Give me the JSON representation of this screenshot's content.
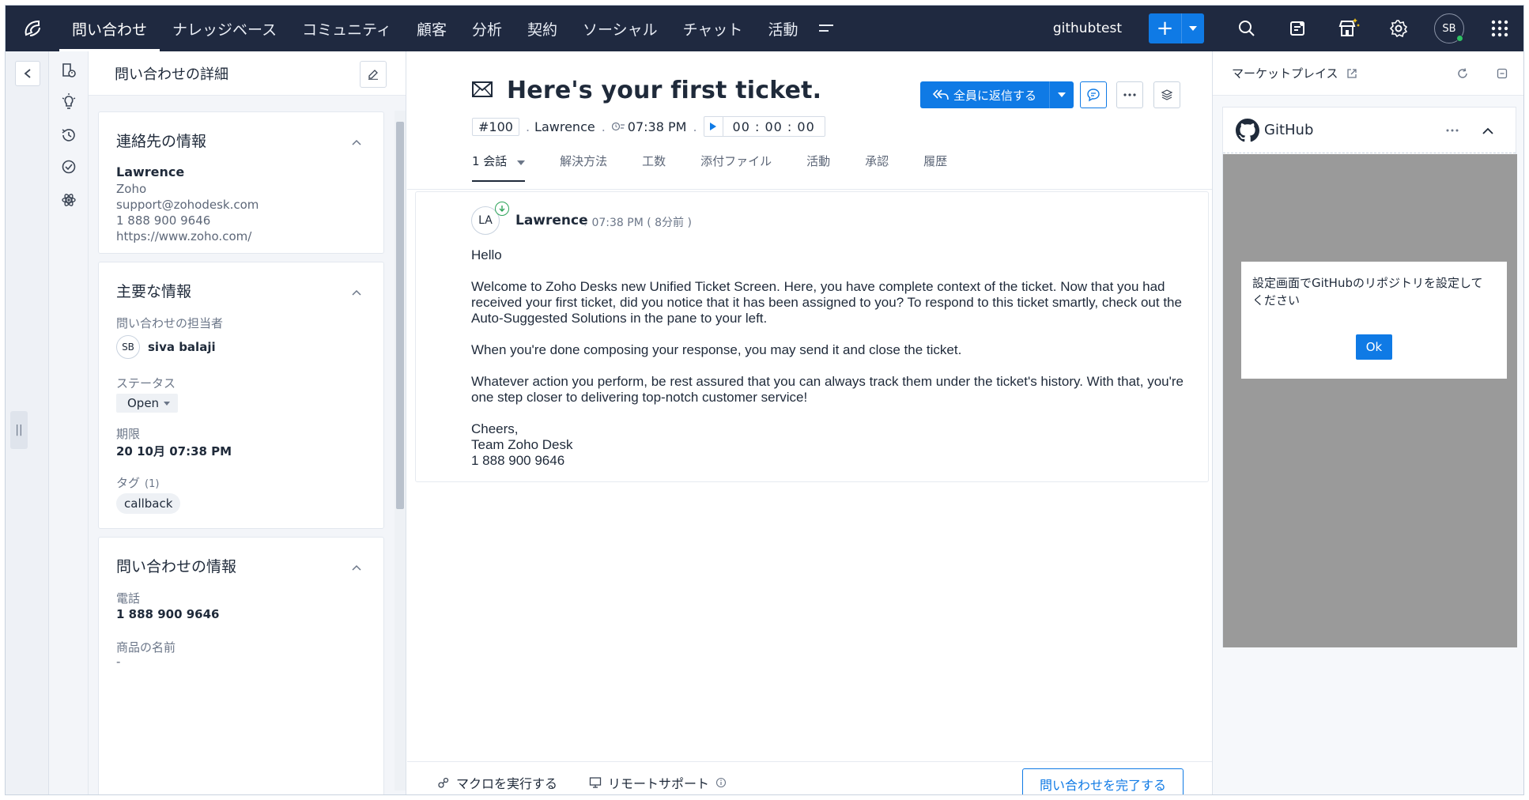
{
  "nav": {
    "items": [
      "問い合わせ",
      "ナレッジベース",
      "コミュニティ",
      "顧客",
      "分析",
      "契約",
      "ソーシャル",
      "チャット",
      "活動"
    ],
    "org_name": "githubtest",
    "avatar_initials": "SB"
  },
  "detail": {
    "header": "問い合わせの詳細",
    "contact_card": {
      "title": "連絡先の情報",
      "name": "Lawrence",
      "company": "Zoho",
      "email": "support@zohodesk.com",
      "phone": "1 888 900 9646",
      "website": "https://www.zoho.com/"
    },
    "key_info_card": {
      "title": "主要な情報",
      "owner_label": "問い合わせの担当者",
      "owner_initials": "SB",
      "owner_name": "siva balaji",
      "status_label": "ステータス",
      "status_value": "Open",
      "due_label": "期限",
      "due_value": "20 10月 07:38 PM",
      "tags_label": "タグ",
      "tags_count": "(1)",
      "tag": "callback"
    },
    "ticket_info_card": {
      "title": "問い合わせの情報",
      "phone_label": "電話",
      "phone_value": "1 888 900 9646",
      "product_label": "商品の名前",
      "product_value": "-"
    }
  },
  "ticket": {
    "subject": "Here's your first ticket.",
    "number": "#100",
    "contact": "Lawrence",
    "time": "07:38 PM",
    "timer": "00 : 00 : 00",
    "reply_all_label": "全員に返信する",
    "tabs": [
      {
        "label": "1 会話"
      },
      {
        "label": "解決方法"
      },
      {
        "label": "工数"
      },
      {
        "label": "添付ファイル"
      },
      {
        "label": "活動"
      },
      {
        "label": "承認"
      },
      {
        "label": "履歴"
      }
    ],
    "thread": {
      "sender_initials": "LA",
      "sender": "Lawrence",
      "sent_time": "07:38 PM ( 8分前 )",
      "paragraphs": [
        "Hello",
        "Welcome to Zoho Desks new Unified Ticket Screen. Here, you have complete context of the ticket. Now that you had received your first ticket, did you notice that it has been assigned to you? To respond to this ticket smartly, check out the Auto-Suggested Solutions in the pane to your left.",
        "When you're done composing your response, you may send it and close the ticket.",
        "Whatever action you perform, be rest assured that you can always track them under the ticket's history. With that, you're one step closer to delivering top-notch customer service!",
        "Cheers,\nTeam Zoho Desk\n1 888 900 9646"
      ]
    },
    "bottom": {
      "macro_label": "マクロを実行する",
      "remote_label": "リモートサポート",
      "complete_label": "問い合わせを完了する"
    }
  },
  "marketplace": {
    "header": "マーケットプレイス",
    "widget_title": "GitHub",
    "dialog_message": "設定画面でGitHubのリポジトリを設定してください",
    "ok_label": "Ok"
  },
  "colors": {
    "nav_bg": "#1f2940",
    "primary": "#0f7ae5",
    "overlay_gray": "#9a9a9a"
  }
}
